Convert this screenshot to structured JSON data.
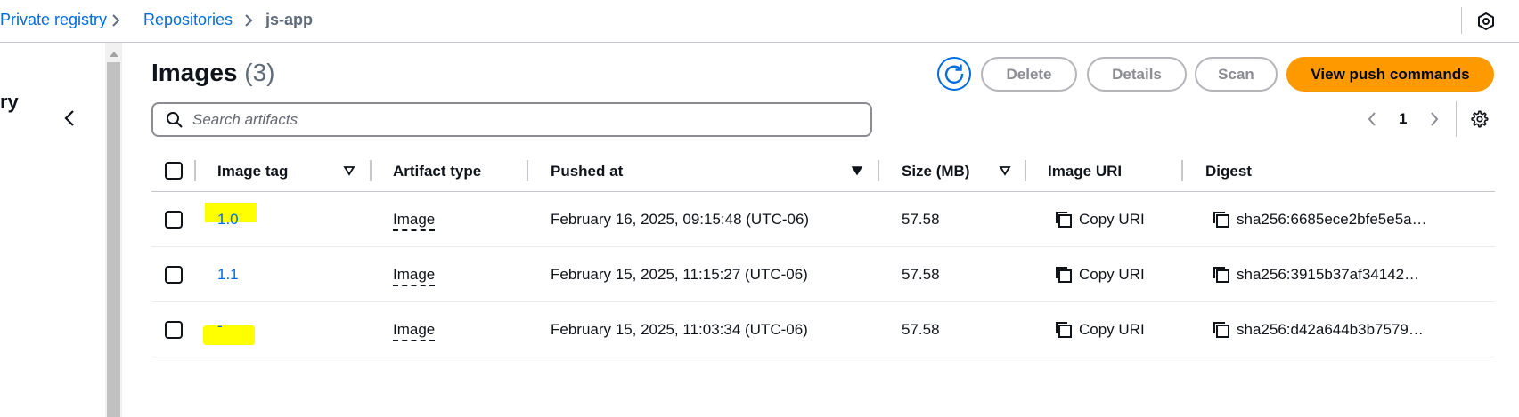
{
  "breadcrumb": {
    "items": [
      "Private registry",
      "Repositories"
    ],
    "current": "js-app"
  },
  "sidebar": {
    "title_fragment": "ry"
  },
  "header": {
    "title": "Images",
    "count": "(3)"
  },
  "actions": {
    "delete": "Delete",
    "details": "Details",
    "scan": "Scan",
    "push": "View push commands"
  },
  "search": {
    "placeholder": "Search artifacts",
    "value": ""
  },
  "pagination": {
    "current_page": "1"
  },
  "table": {
    "columns": [
      "Image tag",
      "Artifact type",
      "Pushed at",
      "Size (MB)",
      "Image URI",
      "Digest"
    ],
    "rows": [
      {
        "tag": "1.0",
        "type": "Image",
        "pushed": "February 16, 2025, 09:15:48 (UTC-06)",
        "size": "57.58",
        "uri": "Copy URI",
        "digest": "sha256:6685ece2bfe5e5a…"
      },
      {
        "tag": "1.1",
        "type": "Image",
        "pushed": "February 15, 2025, 11:15:27 (UTC-06)",
        "size": "57.58",
        "uri": "Copy URI",
        "digest": "sha256:3915b37af34142…"
      },
      {
        "tag": "-",
        "type": "Image",
        "pushed": "February 15, 2025, 11:03:34 (UTC-06)",
        "size": "57.58",
        "uri": "Copy URI",
        "digest": "sha256:d42a644b3b7579…"
      }
    ]
  },
  "colors": {
    "link": "#006ce0",
    "primary": "#ff9900",
    "highlight": "#ffff00"
  }
}
